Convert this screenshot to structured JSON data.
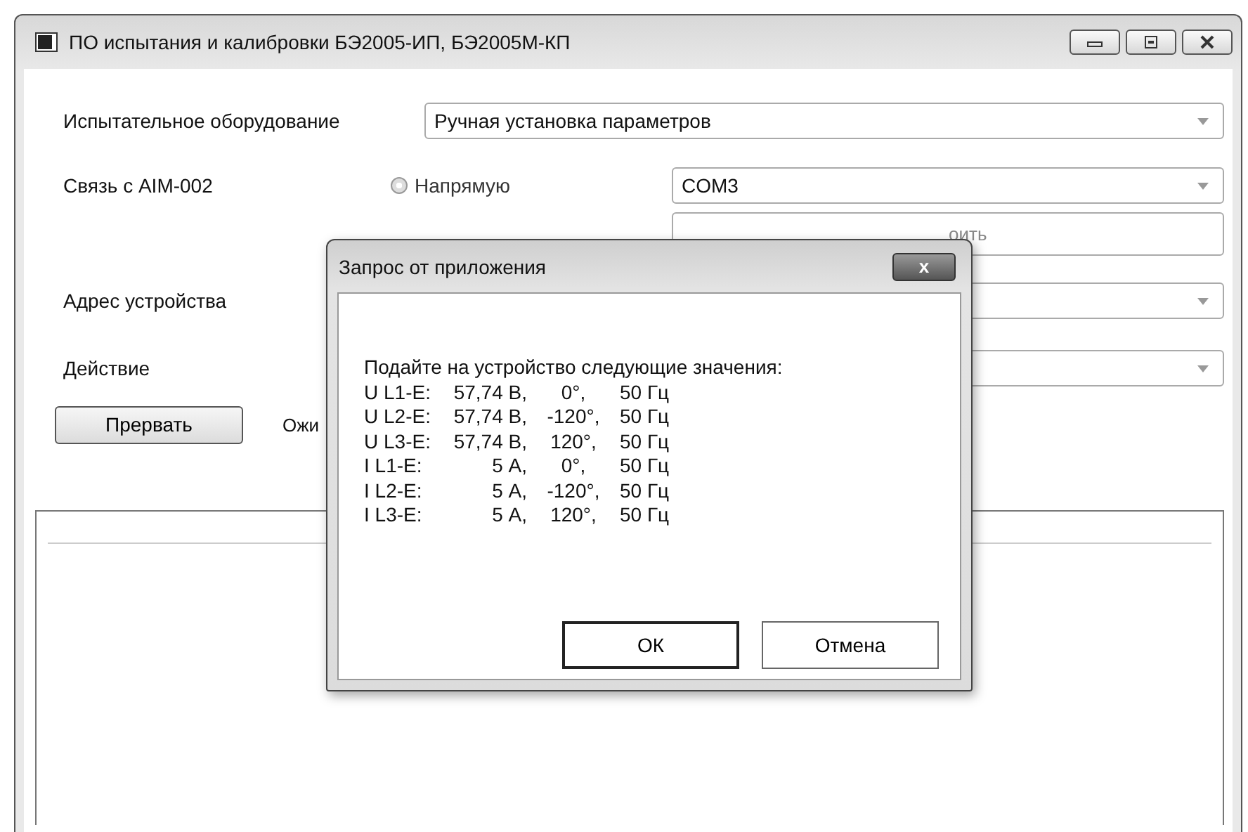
{
  "window": {
    "title": "ПО испытания и калибровки БЭ2005-ИП, БЭ2005М-КП"
  },
  "form": {
    "equipment_label": "Испытательное оборудование",
    "equipment_value": "Ручная установка параметров",
    "link_label": "Связь с AIM-002",
    "link_option": {
      "label": "Напрямую",
      "selected": false
    },
    "port_value": "COM3",
    "address_field_placeholder": "оить",
    "address_label": "Адрес устройства",
    "action_label": "Действие",
    "abort_button": "Прервать",
    "status_text": "Ожи"
  },
  "dialog": {
    "title": "Запрос от приложения",
    "close": "x",
    "heading": "Подайте на устройство следующие значения:",
    "rows": [
      {
        "label": "U L1-E:",
        "magnitude": "57,74 В,",
        "angle": "0°,",
        "frequency": "50 Гц"
      },
      {
        "label": "U L2-E:",
        "magnitude": "57,74 В,",
        "angle": "-120°,",
        "frequency": "50 Гц"
      },
      {
        "label": "U L3-E:",
        "magnitude": "57,74 В,",
        "angle": "120°,",
        "frequency": "50 Гц"
      },
      {
        "label": "I L1-E:",
        "magnitude": "5 А,",
        "angle": "0°,",
        "frequency": "50 Гц"
      },
      {
        "label": "I L2-E:",
        "magnitude": "5 А,",
        "angle": "-120°,",
        "frequency": "50 Гц"
      },
      {
        "label": "I L3-E:",
        "magnitude": "5 А,",
        "angle": "120°,",
        "frequency": "50 Гц"
      }
    ],
    "buttons": [
      "ОК",
      "Отмена"
    ]
  }
}
